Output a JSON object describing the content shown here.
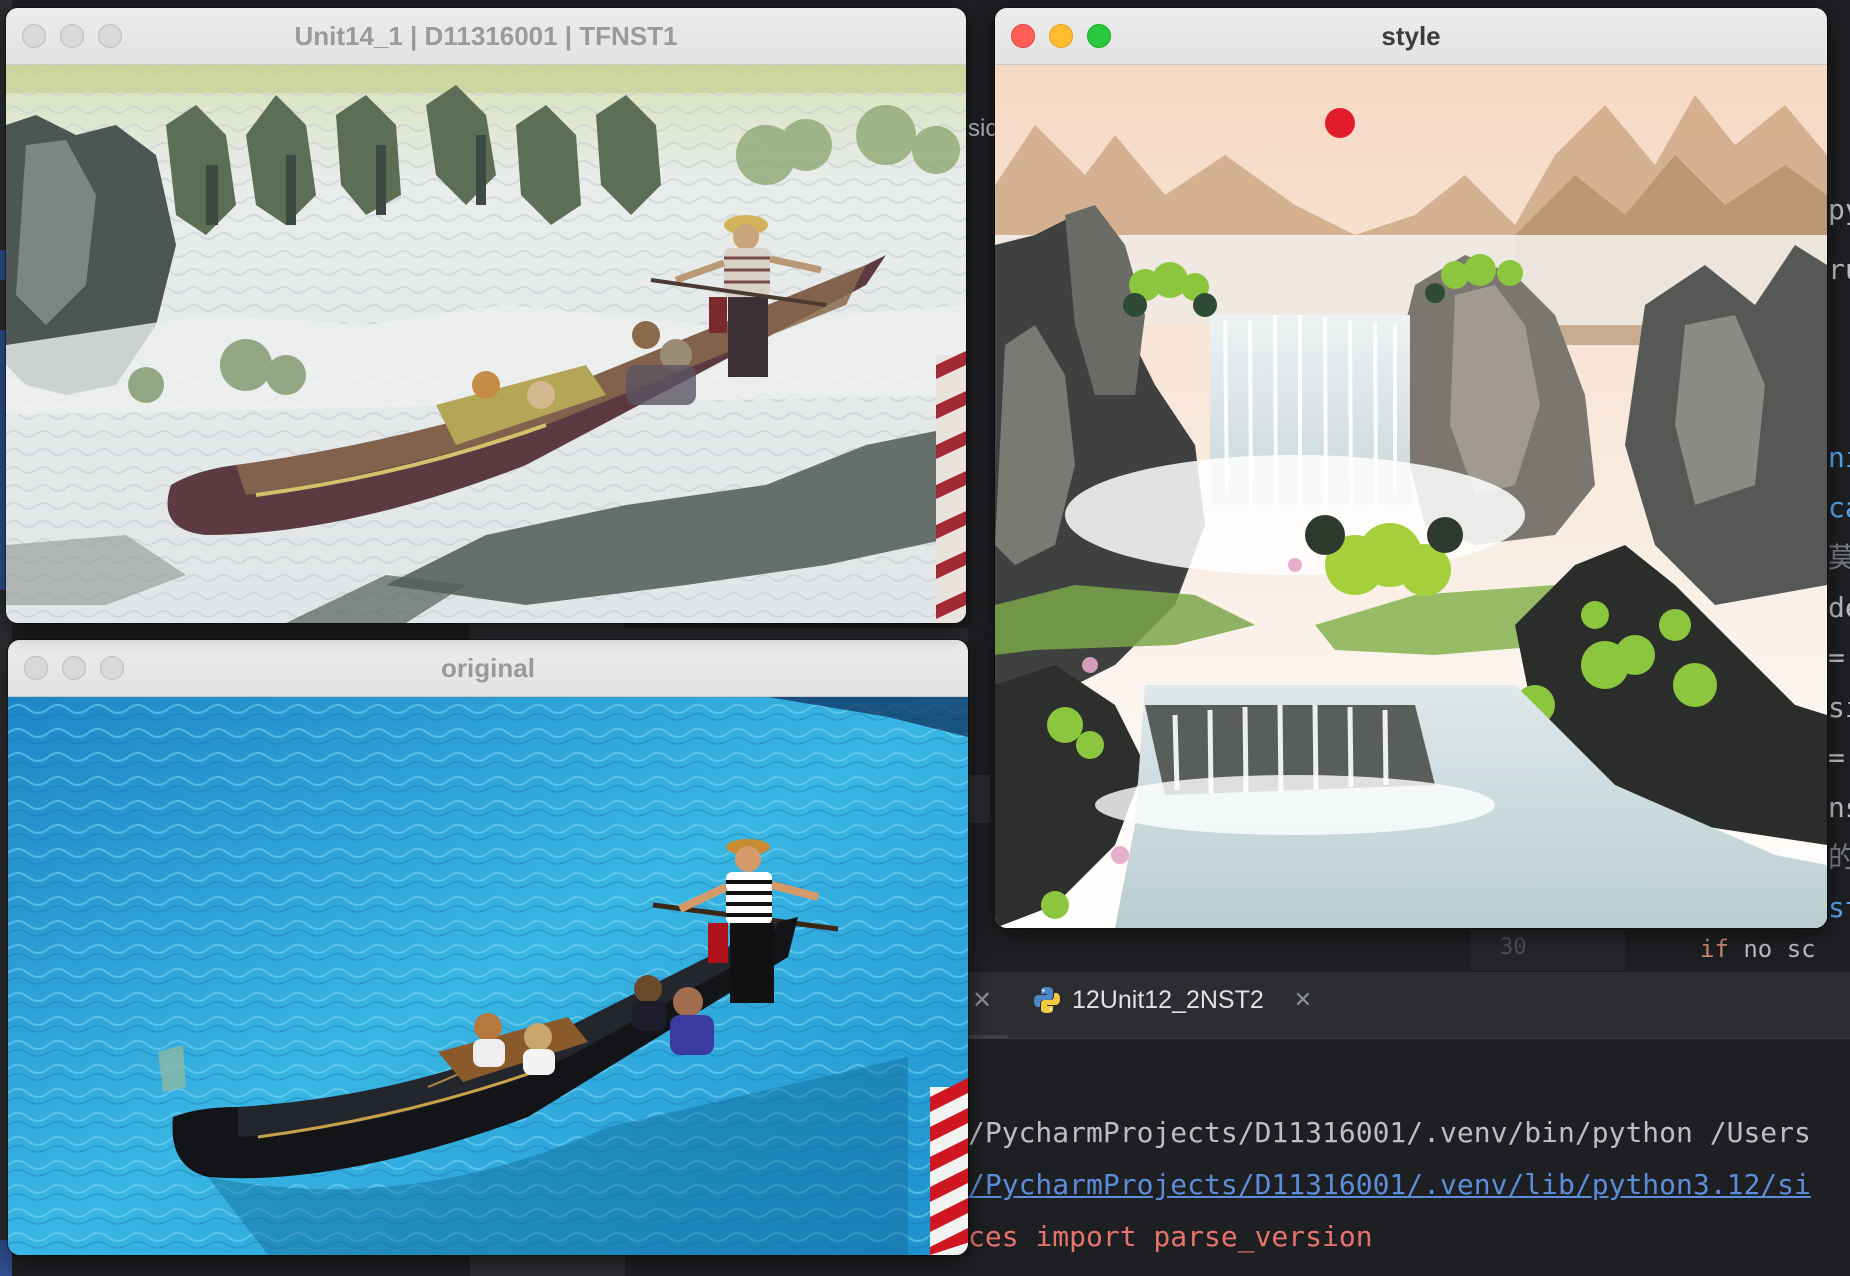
{
  "windows": {
    "stylized": {
      "title": "Unit14_1 | D11316001 | TFNST1",
      "traffic_lights": "inactive"
    },
    "original": {
      "title": "original",
      "traffic_lights": "inactive"
    },
    "style": {
      "title": "style",
      "traffic_lights": "active"
    }
  },
  "ide": {
    "run_tab": {
      "label": "12Unit12_2NST2",
      "icon": "python-icon"
    },
    "editor_peek": "sic",
    "side_fragments": [
      "py",
      "ru",
      "ni",
      "ca",
      "莫#",
      "de",
      "=",
      "si",
      "=",
      "ns",
      "的#",
      "st"
    ],
    "line_number": "30",
    "code_keyword": "if",
    "code_rest": " no sc",
    "console_lines": [
      "/PycharmProjects/D11316001/.venv/bin/python /Users",
      "/PycharmProjects/D11316001/.venv/lib/python3.12/si",
      "ces import parse_version"
    ]
  },
  "colors": {
    "ide_bg": "#1e1f22",
    "link": "#5c8dd8",
    "error": "#e8736c",
    "close_red": "#ff5f57",
    "minimize_yellow": "#febc2e",
    "zoom_green": "#28c840"
  }
}
